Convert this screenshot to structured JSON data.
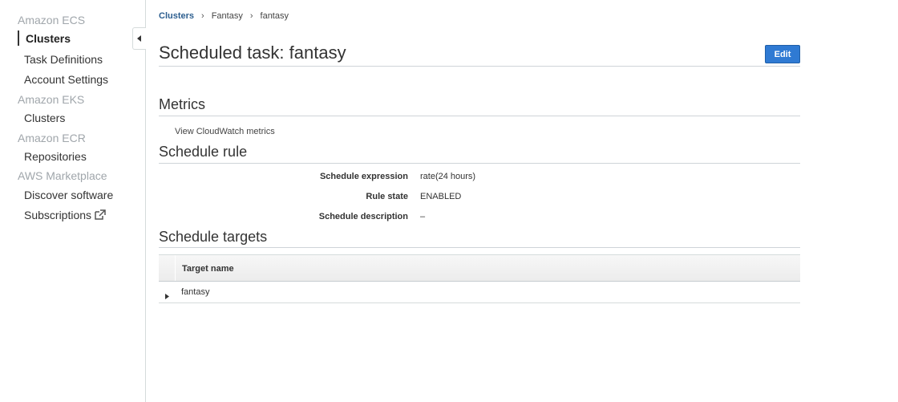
{
  "sidebar": {
    "sections": [
      {
        "title": "Amazon ECS",
        "items": [
          {
            "label": "Clusters",
            "active": true
          },
          {
            "label": "Task Definitions"
          },
          {
            "label": "Account Settings"
          }
        ]
      },
      {
        "title": "Amazon EKS",
        "items": [
          {
            "label": "Clusters"
          }
        ]
      },
      {
        "title": "Amazon ECR",
        "items": [
          {
            "label": "Repositories"
          }
        ]
      },
      {
        "title": "AWS Marketplace",
        "items": [
          {
            "label": "Discover software"
          },
          {
            "label": "Subscriptions",
            "icon": "external-link-icon"
          }
        ]
      }
    ],
    "collapse_icon": "caret-left-icon"
  },
  "breadcrumb": {
    "items": [
      "Clusters",
      "Fantasy",
      "fantasy"
    ],
    "separator": "›"
  },
  "page": {
    "title": "Scheduled task: fantasy",
    "edit_label": "Edit"
  },
  "metrics": {
    "heading": "Metrics",
    "link": "View CloudWatch metrics"
  },
  "schedule_rule": {
    "heading": "Schedule rule",
    "fields": [
      {
        "key": "Schedule expression",
        "value": "rate(24 hours)"
      },
      {
        "key": "Rule state",
        "value": "ENABLED"
      },
      {
        "key": "Schedule description",
        "value": "–"
      }
    ]
  },
  "schedule_targets": {
    "heading": "Schedule targets",
    "columns": [
      "Target name"
    ],
    "rows": [
      {
        "name": "fantasy",
        "expand_icon": "caret-right-icon"
      }
    ]
  },
  "colors": {
    "accent": "#2f7ad3",
    "breadcrumb_link": "#2c5e8f",
    "sidebar_section": "#a0a6ab"
  }
}
